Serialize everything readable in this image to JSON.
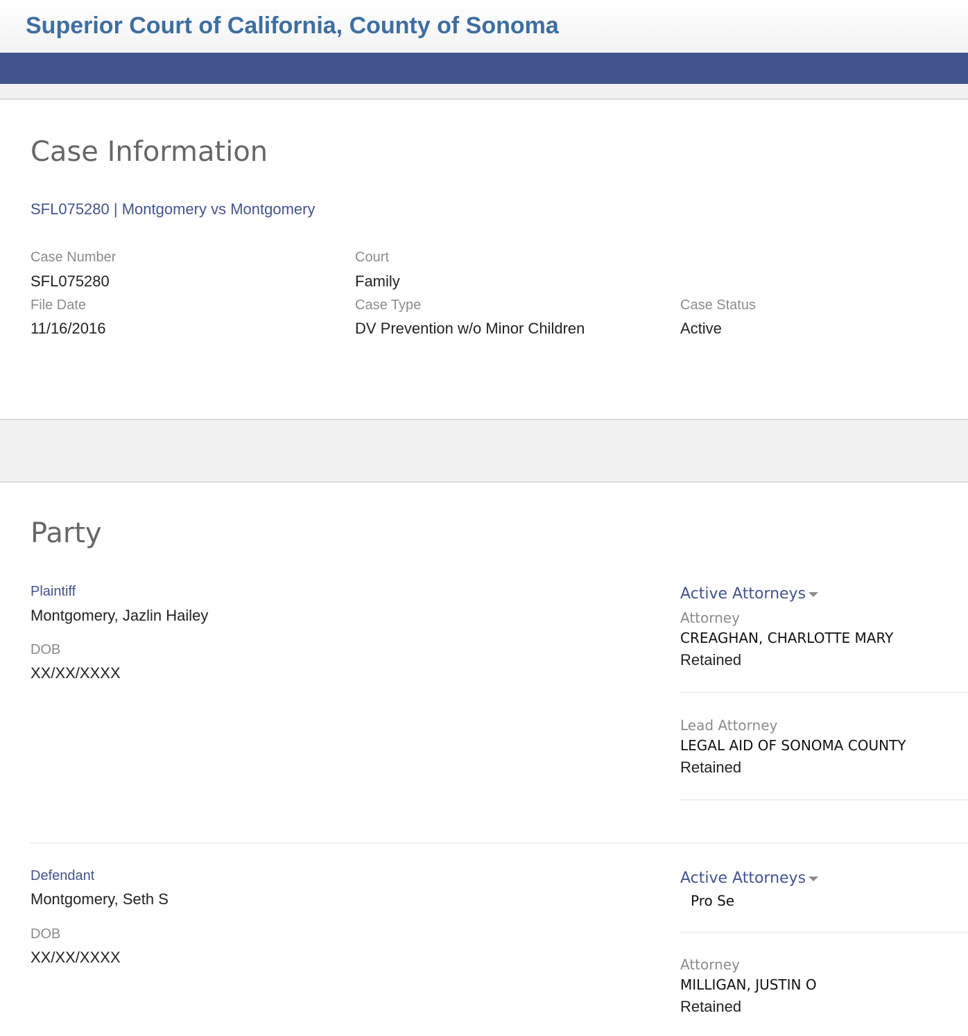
{
  "header": {
    "title": "Superior Court of California, County of Sonoma"
  },
  "case_info": {
    "title": "Case Information",
    "case_link": "SFL075280 | Montgomery vs Montgomery",
    "fields": {
      "case_number": {
        "label": "Case Number",
        "value": "SFL075280"
      },
      "court": {
        "label": "Court",
        "value": "Family"
      },
      "file_date": {
        "label": "File Date",
        "value": "11/16/2016"
      },
      "case_type": {
        "label": "Case Type",
        "value": "DV Prevention w/o Minor Children"
      },
      "case_status": {
        "label": "Case Status",
        "value": "Active"
      }
    }
  },
  "party": {
    "title": "Party",
    "parties": [
      {
        "role": "Plaintiff",
        "name": "Montgomery, Jazlin Hailey",
        "dob_label": "DOB",
        "dob": "XX/XX/XXXX",
        "attorneys_toggle": "Active Attorneys",
        "attorneys": [
          {
            "label": "Attorney",
            "name": "CREAGHAN, CHARLOTTE MARY",
            "status": "Retained"
          },
          {
            "label": "Lead Attorney",
            "name": "LEGAL AID OF SONOMA COUNTY",
            "status": "Retained"
          }
        ]
      },
      {
        "role": "Defendant",
        "name": "Montgomery, Seth S",
        "dob_label": "DOB",
        "dob": "XX/XX/XXXX",
        "attorneys_toggle": "Active Attorneys",
        "pro_se": "Pro Se",
        "attorneys": [
          {
            "label": "Attorney",
            "name": "MILLIGAN, JUSTIN O",
            "status": "Retained"
          }
        ]
      }
    ]
  }
}
